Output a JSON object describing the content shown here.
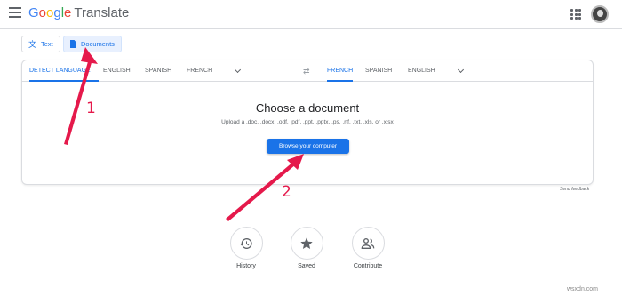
{
  "header": {
    "logo": {
      "g1": "G",
      "o1": "o",
      "o2": "o",
      "g2": "g",
      "l": "l",
      "e": "e",
      "product": "Translate"
    },
    "icons": {
      "menu": "hamburger-menu-icon",
      "apps": "google-apps-icon",
      "avatar": "user-avatar"
    }
  },
  "mode_tabs": {
    "text": {
      "icon": "translate-icon",
      "label": "Text"
    },
    "documents": {
      "icon": "document-icon",
      "label": "Documents"
    }
  },
  "source_languages": {
    "detect": "DETECT LANGUAGE",
    "items": [
      "ENGLISH",
      "SPANISH",
      "FRENCH"
    ]
  },
  "target_languages": {
    "items": [
      "FRENCH",
      "SPANISH",
      "ENGLISH"
    ]
  },
  "swap_icon": "⇄",
  "upload": {
    "title": "Choose a document",
    "subtitle": "Upload a .doc, .docx, .odf, .pdf, .ppt, .pptx, .ps, .rtf, .txt, .xls, or .xlsx",
    "browse_label": "Browse your computer"
  },
  "send_feedback": "Send feedback",
  "actions": [
    {
      "label": "History",
      "icon": "history-icon"
    },
    {
      "label": "Saved",
      "icon": "star-icon"
    },
    {
      "label": "Contribute",
      "icon": "contribute-icon"
    }
  ],
  "annotations": {
    "step1": "1",
    "step2": "2",
    "color": "#e5194b"
  },
  "colors": {
    "accent": "#1a73e8",
    "active_tab_bg": "#e8f0fe"
  },
  "watermark": "wsxdn.com"
}
